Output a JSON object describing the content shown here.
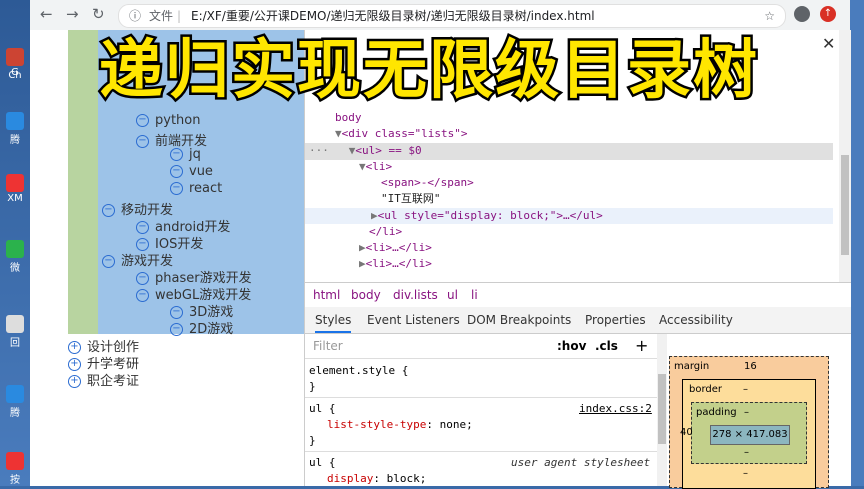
{
  "browser": {
    "file_label": "文件",
    "url": "E:/XF/重要/公开课DEMO/递归无限级目录树/递归无限级目录树/index.html"
  },
  "banner": {
    "title": "递归实现无限级目录树"
  },
  "desktop": {
    "icons": [
      "G",
      "Ch",
      "腾",
      "XM",
      "微",
      "回",
      "腾",
      "按"
    ]
  },
  "tree": {
    "visible_top": [
      {
        "label": "python",
        "level": 2,
        "sign": "−"
      },
      {
        "label": "前端开发",
        "level": 2,
        "sign": "−"
      },
      {
        "label": "jq",
        "level": 3,
        "sign": "−"
      },
      {
        "label": "vue",
        "level": 3,
        "sign": "−"
      },
      {
        "label": "react",
        "level": 3,
        "sign": "−"
      },
      {
        "label": "移动开发",
        "level": 1,
        "sign": "−"
      },
      {
        "label": "android开发",
        "level": 2,
        "sign": "−"
      },
      {
        "label": "IOS开发",
        "level": 2,
        "sign": "−"
      },
      {
        "label": "游戏开发",
        "level": 1,
        "sign": "−"
      },
      {
        "label": "phaser游戏开发",
        "level": 2,
        "sign": "−"
      },
      {
        "label": "webGL游戏开发",
        "level": 2,
        "sign": "−"
      },
      {
        "label": "3D游戏",
        "level": 3,
        "sign": "−"
      },
      {
        "label": "2D游戏",
        "level": 3,
        "sign": "−"
      }
    ],
    "collapsed": [
      {
        "label": "设计创作",
        "sign": "+"
      },
      {
        "label": "升学考研",
        "sign": "+"
      },
      {
        "label": "职企考证",
        "sign": "+"
      }
    ]
  },
  "devtools": {
    "lines": {
      "body_open": "body",
      "div_open": "<div class=\"lists\">",
      "ul_open": "<ul> == $0",
      "li_open": "<li>",
      "span": "<span>-</span>",
      "text": "\"IT互联网\"",
      "ul_inner": "<ul style=\"display: block;\">…</ul>",
      "li_close": "</li>",
      "li_collapsed": "<li>…</li>"
    },
    "breadcrumb": [
      "html",
      "body",
      "div.lists",
      "ul",
      "li"
    ],
    "tabs": [
      "Styles",
      "Event Listeners",
      "DOM Breakpoints",
      "Properties",
      "Accessibility"
    ],
    "filter_placeholder": "Filter",
    "hov": ":hov",
    "cls": ".cls",
    "plus": "+",
    "rules": {
      "element_style": "element.style {",
      "close": "}",
      "ul_selector": "ul {",
      "ul_source": "index.css:2",
      "ul_prop": "list-style-type",
      "ul_value": "none;",
      "ua_selector": "ul {",
      "ua_source": "user agent stylesheet",
      "ua_prop": "display",
      "ua_value": "block;"
    },
    "box_model": {
      "margin_label": "margin",
      "margin_value": "16",
      "border_label": "border",
      "border_value": "–",
      "padding_label": "padding",
      "padding_value": "–",
      "content_size": "278 × 417.083",
      "left_padding": "40",
      "dash": "–"
    }
  }
}
